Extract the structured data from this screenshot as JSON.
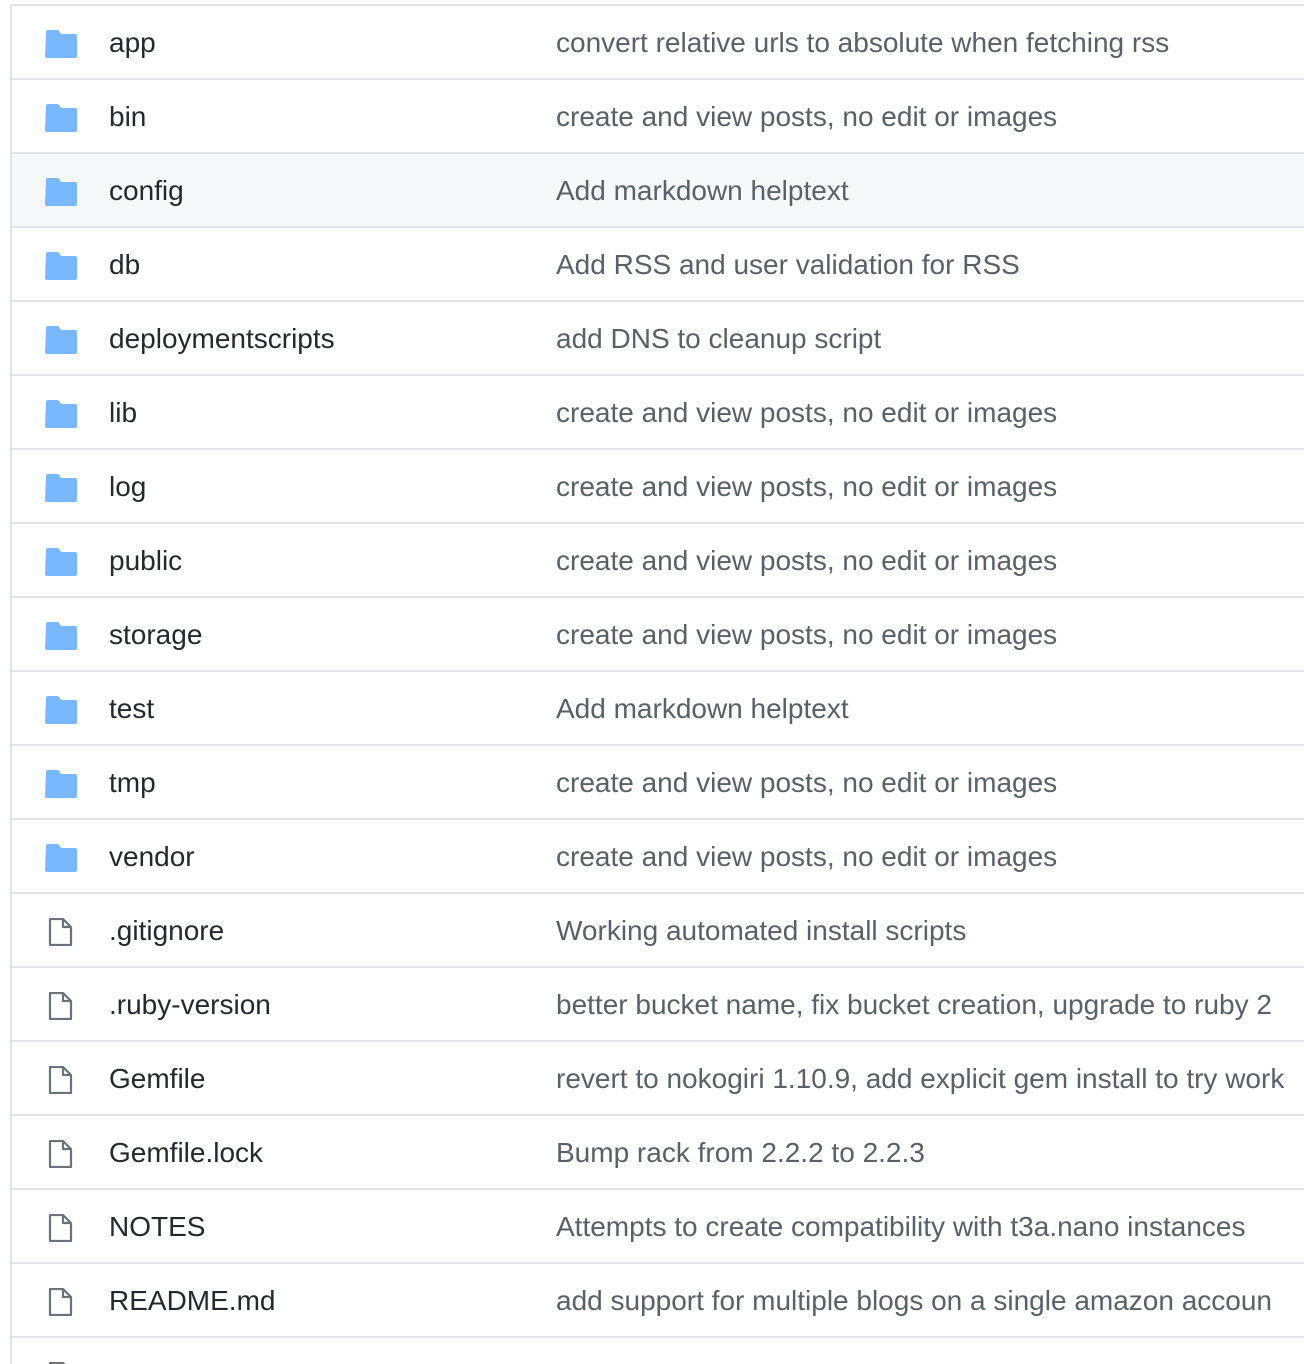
{
  "colors": {
    "folder": "#79b8ff",
    "file_icon": "#6a737d",
    "name_text": "#24292e",
    "message_text": "#586069",
    "border": "#e1e4e8",
    "hover_row": "#f6f8fa"
  },
  "files": [
    {
      "type": "folder",
      "icon": "folder-icon",
      "name": "app",
      "message": "convert relative urls to absolute when fetching rss"
    },
    {
      "type": "folder",
      "icon": "folder-icon",
      "name": "bin",
      "message": "create and view posts, no edit or images"
    },
    {
      "type": "folder",
      "icon": "folder-icon",
      "name": "config",
      "message": "Add markdown helptext",
      "hovered": true
    },
    {
      "type": "folder",
      "icon": "folder-icon",
      "name": "db",
      "message": "Add RSS and user validation for RSS"
    },
    {
      "type": "folder",
      "icon": "folder-icon",
      "name": "deploymentscripts",
      "message": "add DNS to cleanup script"
    },
    {
      "type": "folder",
      "icon": "folder-icon",
      "name": "lib",
      "message": "create and view posts, no edit or images"
    },
    {
      "type": "folder",
      "icon": "folder-icon",
      "name": "log",
      "message": "create and view posts, no edit or images"
    },
    {
      "type": "folder",
      "icon": "folder-icon",
      "name": "public",
      "message": "create and view posts, no edit or images"
    },
    {
      "type": "folder",
      "icon": "folder-icon",
      "name": "storage",
      "message": "create and view posts, no edit or images"
    },
    {
      "type": "folder",
      "icon": "folder-icon",
      "name": "test",
      "message": "Add markdown helptext"
    },
    {
      "type": "folder",
      "icon": "folder-icon",
      "name": "tmp",
      "message": "create and view posts, no edit or images"
    },
    {
      "type": "folder",
      "icon": "folder-icon",
      "name": "vendor",
      "message": "create and view posts, no edit or images"
    },
    {
      "type": "file",
      "icon": "file-icon",
      "name": ".gitignore",
      "message": "Working automated install scripts"
    },
    {
      "type": "file",
      "icon": "file-icon",
      "name": ".ruby-version",
      "message": "better bucket name, fix bucket creation, upgrade to ruby 2"
    },
    {
      "type": "file",
      "icon": "file-icon",
      "name": "Gemfile",
      "message": "revert to nokogiri 1.10.9, add explicit gem install to try work"
    },
    {
      "type": "file",
      "icon": "file-icon",
      "name": "Gemfile.lock",
      "message": "Bump rack from 2.2.2 to 2.2.3"
    },
    {
      "type": "file",
      "icon": "file-icon",
      "name": "NOTES",
      "message": "Attempts to create compatibility with t3a.nano instances"
    },
    {
      "type": "file",
      "icon": "file-icon",
      "name": "README.md",
      "message": "add support for multiple blogs on a single amazon accoun"
    },
    {
      "type": "file",
      "icon": "file-icon",
      "name": "",
      "message": ""
    }
  ]
}
